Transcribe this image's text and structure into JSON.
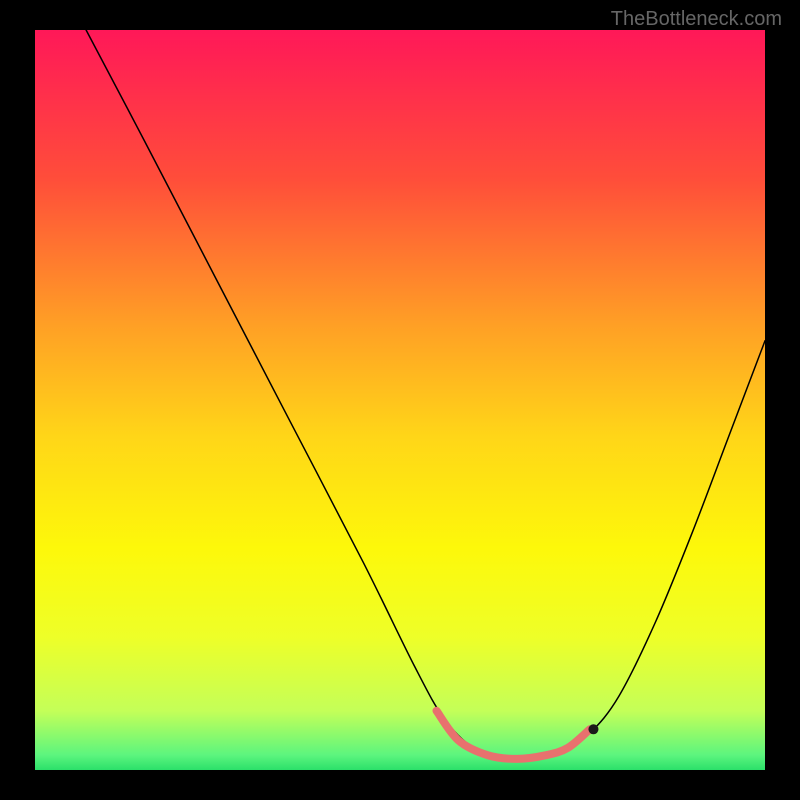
{
  "watermark": "TheBottleneck.com",
  "chart_data": {
    "type": "line",
    "title": "",
    "xlabel": "",
    "ylabel": "",
    "xlim": [
      0,
      100
    ],
    "ylim": [
      0,
      100
    ],
    "gradient_stops": [
      {
        "offset": 0,
        "color": "#ff1858"
      },
      {
        "offset": 20,
        "color": "#ff4d3a"
      },
      {
        "offset": 40,
        "color": "#ffa025"
      },
      {
        "offset": 55,
        "color": "#ffd618"
      },
      {
        "offset": 70,
        "color": "#fdf80a"
      },
      {
        "offset": 82,
        "color": "#eeff28"
      },
      {
        "offset": 92,
        "color": "#c4ff58"
      },
      {
        "offset": 98,
        "color": "#5cf57e"
      },
      {
        "offset": 100,
        "color": "#2be06a"
      }
    ],
    "series": [
      {
        "name": "bottleneck-curve",
        "color": "#000000",
        "stroke_width": 1.5,
        "points": [
          {
            "x": 7,
            "y": 100
          },
          {
            "x": 15,
            "y": 85
          },
          {
            "x": 25,
            "y": 66
          },
          {
            "x": 35,
            "y": 47
          },
          {
            "x": 45,
            "y": 28
          },
          {
            "x": 52,
            "y": 14
          },
          {
            "x": 56,
            "y": 7
          },
          {
            "x": 60,
            "y": 3
          },
          {
            "x": 64,
            "y": 1.5
          },
          {
            "x": 68,
            "y": 1.5
          },
          {
            "x": 72,
            "y": 2.5
          },
          {
            "x": 76,
            "y": 5
          },
          {
            "x": 80,
            "y": 10
          },
          {
            "x": 85,
            "y": 20
          },
          {
            "x": 90,
            "y": 32
          },
          {
            "x": 95,
            "y": 45
          },
          {
            "x": 100,
            "y": 58
          }
        ]
      },
      {
        "name": "highlight-zone",
        "color": "#e8716e",
        "stroke_width": 8,
        "points": [
          {
            "x": 55,
            "y": 8
          },
          {
            "x": 58,
            "y": 4
          },
          {
            "x": 62,
            "y": 2
          },
          {
            "x": 66,
            "y": 1.5
          },
          {
            "x": 70,
            "y": 2
          },
          {
            "x": 73,
            "y": 3
          },
          {
            "x": 76,
            "y": 5.5
          }
        ]
      },
      {
        "name": "highlight-dot",
        "color": "#1a1a1a",
        "type_hint": "point",
        "points": [
          {
            "x": 76.5,
            "y": 5.5
          }
        ]
      }
    ]
  }
}
